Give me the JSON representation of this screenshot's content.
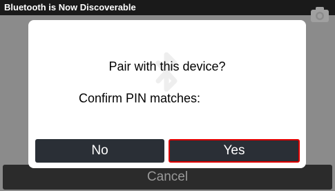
{
  "topbar": {
    "title": "Bluetooth is Now Discoverable",
    "camera_icon": "camera-icon"
  },
  "background_action": {
    "cancel_label": "Cancel"
  },
  "dialog": {
    "watermark_icon": "bluetooth-icon",
    "title": "Pair with this device?",
    "pin_label": "Confirm PIN matches:",
    "buttons": {
      "no_label": "No",
      "yes_label": "Yes"
    },
    "highlight_color": "#e00000"
  }
}
